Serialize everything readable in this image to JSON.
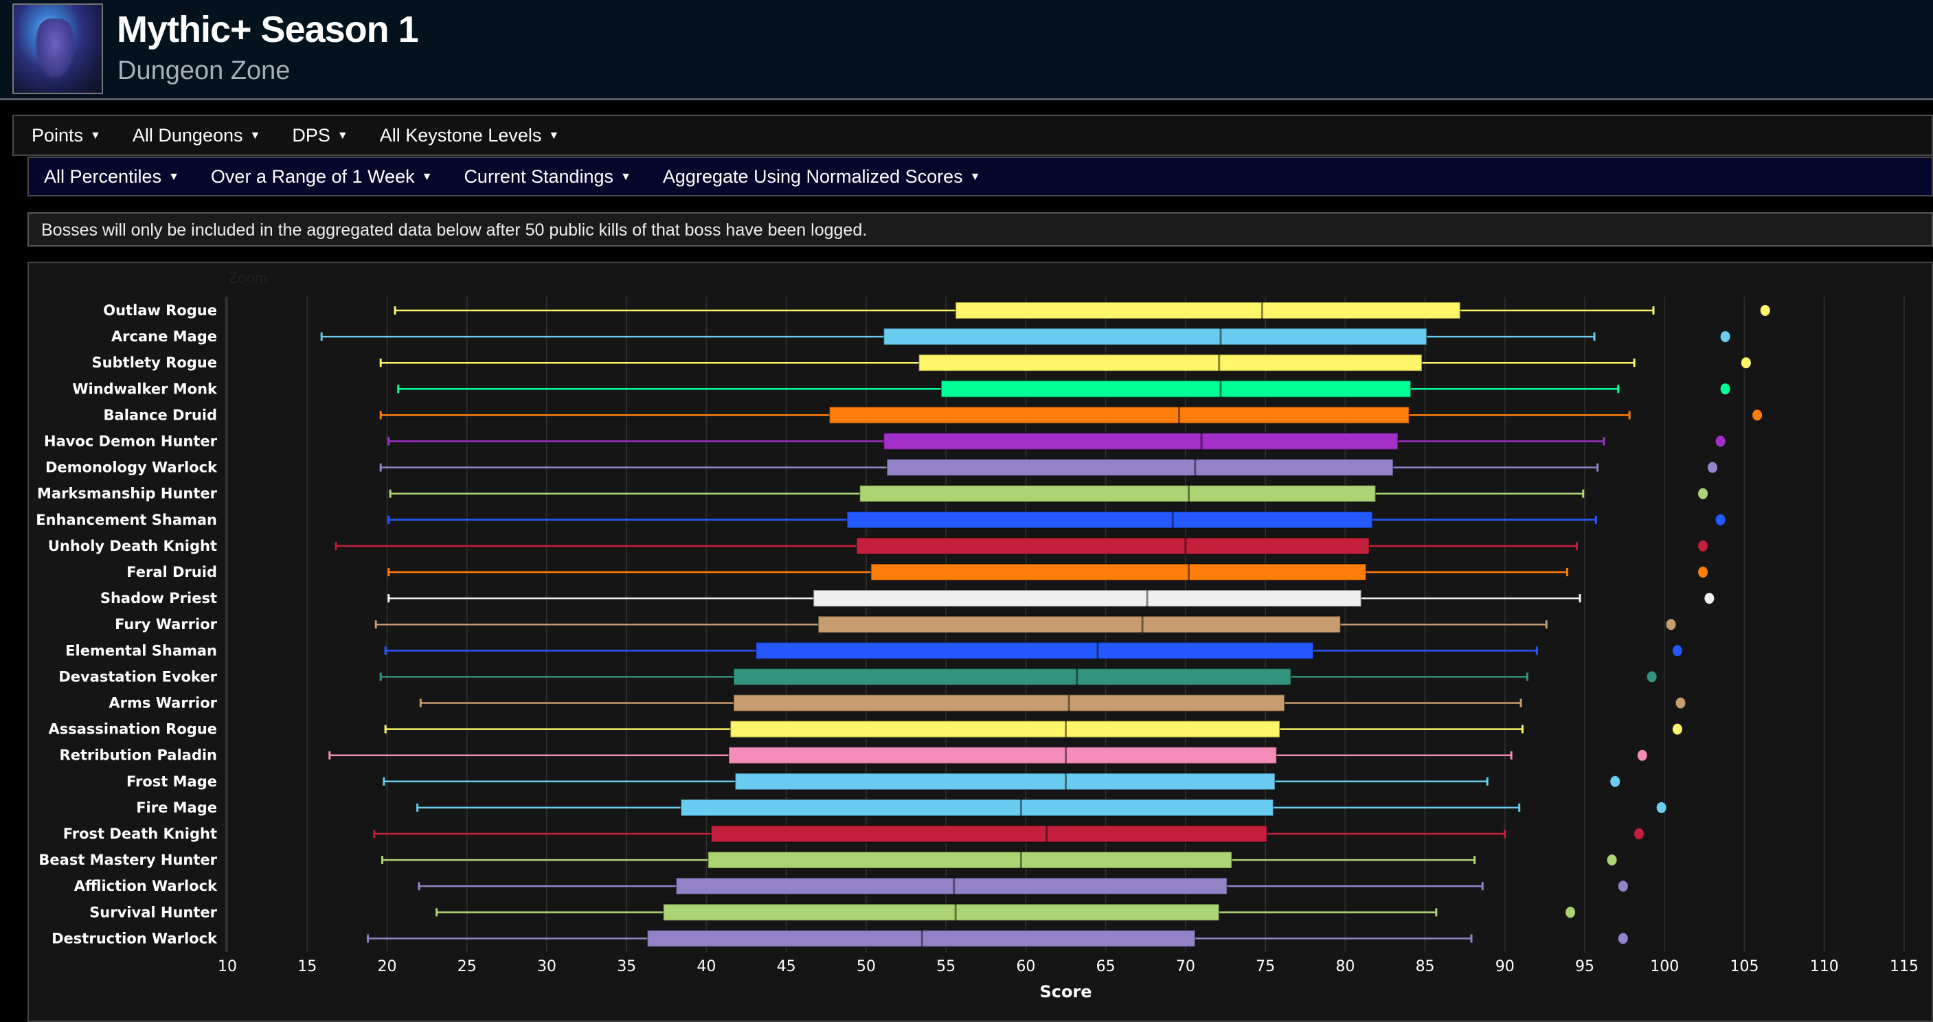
{
  "header": {
    "title": "Mythic+ Season 1",
    "subtitle": "Dungeon Zone",
    "icon": "zone-icon"
  },
  "nav_primary": [
    {
      "label": "Points"
    },
    {
      "label": "All Dungeons"
    },
    {
      "label": "DPS"
    },
    {
      "label": "All Keystone Levels"
    }
  ],
  "nav_secondary": [
    {
      "label": "All Percentiles"
    },
    {
      "label": "Over a Range of 1 Week"
    },
    {
      "label": "Current Standings"
    },
    {
      "label": "Aggregate Using Normalized Scores"
    }
  ],
  "caret": "▼",
  "notice": "Bosses will only be included in the aggregated data below after 50 public kills of that boss have been logged.",
  "zoom_label": "Zoom",
  "chart_data": {
    "type": "boxplot",
    "orientation": "horizontal",
    "xlabel": "Score",
    "xlim": [
      10,
      115
    ],
    "xticks": [
      10,
      15,
      20,
      25,
      30,
      35,
      40,
      45,
      50,
      55,
      60,
      65,
      70,
      75,
      80,
      85,
      90,
      95,
      100,
      105,
      110,
      115
    ],
    "grid": true,
    "categories": [
      "Outlaw Rogue",
      "Arcane Mage",
      "Subtlety Rogue",
      "Windwalker Monk",
      "Balance Druid",
      "Havoc Demon Hunter",
      "Demonology Warlock",
      "Marksmanship Hunter",
      "Enhancement Shaman",
      "Unholy Death Knight",
      "Feral Druid",
      "Shadow Priest",
      "Fury Warrior",
      "Elemental Shaman",
      "Devastation Evoker",
      "Arms Warrior",
      "Assassination Rogue",
      "Retribution Paladin",
      "Frost Mage",
      "Fire Mage",
      "Frost Death Knight",
      "Beast Mastery Hunter",
      "Affliction Warlock",
      "Survival Hunter",
      "Destruction Warlock"
    ],
    "series": [
      {
        "low": 20.5,
        "q1": 55.6,
        "median": 74.8,
        "q3": 87.2,
        "high": 99.3,
        "outlier": 106.3,
        "color": "#fff569"
      },
      {
        "low": 15.9,
        "q1": 51.1,
        "median": 72.2,
        "q3": 85.1,
        "high": 95.6,
        "outlier": 103.8,
        "color": "#69ccf0"
      },
      {
        "low": 19.6,
        "q1": 53.3,
        "median": 72.1,
        "q3": 84.8,
        "high": 98.1,
        "outlier": 105.1,
        "color": "#fff569"
      },
      {
        "low": 20.7,
        "q1": 54.7,
        "median": 72.2,
        "q3": 84.1,
        "high": 97.1,
        "outlier": 103.8,
        "color": "#00ff96"
      },
      {
        "low": 19.6,
        "q1": 47.7,
        "median": 69.6,
        "q3": 84.0,
        "high": 97.8,
        "outlier": 105.8,
        "color": "#ff7d0a"
      },
      {
        "low": 20.1,
        "q1": 51.1,
        "median": 71.0,
        "q3": 83.3,
        "high": 96.2,
        "outlier": 103.5,
        "color": "#a330c9"
      },
      {
        "low": 19.6,
        "q1": 51.3,
        "median": 70.6,
        "q3": 83.0,
        "high": 95.8,
        "outlier": 103.0,
        "color": "#9482c9"
      },
      {
        "low": 20.2,
        "q1": 49.6,
        "median": 70.2,
        "q3": 81.9,
        "high": 94.9,
        "outlier": 102.4,
        "color": "#abd473"
      },
      {
        "low": 20.1,
        "q1": 48.8,
        "median": 69.2,
        "q3": 81.7,
        "high": 95.7,
        "outlier": 103.5,
        "color": "#2459ff"
      },
      {
        "low": 16.8,
        "q1": 49.4,
        "median": 70.0,
        "q3": 81.5,
        "high": 94.5,
        "outlier": 102.4,
        "color": "#c41f3b"
      },
      {
        "low": 20.1,
        "q1": 50.3,
        "median": 70.2,
        "q3": 81.3,
        "high": 93.9,
        "outlier": 102.4,
        "color": "#ff7d0a"
      },
      {
        "low": 20.1,
        "q1": 46.7,
        "median": 67.6,
        "q3": 81.0,
        "high": 94.7,
        "outlier": 102.8,
        "color": "#f0f0f0"
      },
      {
        "low": 19.3,
        "q1": 47.0,
        "median": 67.3,
        "q3": 79.7,
        "high": 92.6,
        "outlier": 100.4,
        "color": "#c79c6e"
      },
      {
        "low": 19.9,
        "q1": 43.1,
        "median": 64.5,
        "q3": 78.0,
        "high": 92.0,
        "outlier": 100.8,
        "color": "#2459ff"
      },
      {
        "low": 19.6,
        "q1": 41.7,
        "median": 63.2,
        "q3": 76.6,
        "high": 91.4,
        "outlier": 99.2,
        "color": "#33937f"
      },
      {
        "low": 22.1,
        "q1": 41.7,
        "median": 62.7,
        "q3": 76.2,
        "high": 91.0,
        "outlier": 101.0,
        "color": "#c79c6e"
      },
      {
        "low": 19.9,
        "q1": 41.5,
        "median": 62.5,
        "q3": 75.9,
        "high": 91.1,
        "outlier": 100.8,
        "color": "#fff569"
      },
      {
        "low": 16.4,
        "q1": 41.4,
        "median": 62.5,
        "q3": 75.7,
        "high": 90.4,
        "outlier": 98.6,
        "color": "#f58cba"
      },
      {
        "low": 19.8,
        "q1": 41.8,
        "median": 62.5,
        "q3": 75.6,
        "high": 88.9,
        "outlier": 96.9,
        "color": "#69ccf0"
      },
      {
        "low": 21.9,
        "q1": 38.4,
        "median": 59.7,
        "q3": 75.5,
        "high": 90.9,
        "outlier": 99.8,
        "color": "#69ccf0"
      },
      {
        "low": 19.2,
        "q1": 40.3,
        "median": 61.3,
        "q3": 75.1,
        "high": 90.0,
        "outlier": 98.4,
        "color": "#c41f3b"
      },
      {
        "low": 19.7,
        "q1": 40.1,
        "median": 59.7,
        "q3": 72.9,
        "high": 88.1,
        "outlier": 96.7,
        "color": "#abd473"
      },
      {
        "low": 22.0,
        "q1": 38.1,
        "median": 55.5,
        "q3": 72.6,
        "high": 88.6,
        "outlier": 97.4,
        "color": "#9482c9"
      },
      {
        "low": 23.1,
        "q1": 37.3,
        "median": 55.6,
        "q3": 72.1,
        "high": 85.7,
        "outlier": 94.1,
        "color": "#abd473"
      },
      {
        "low": 18.8,
        "q1": 36.3,
        "median": 53.5,
        "q3": 70.6,
        "high": 87.9,
        "outlier": 97.4,
        "color": "#9482c9"
      }
    ]
  }
}
